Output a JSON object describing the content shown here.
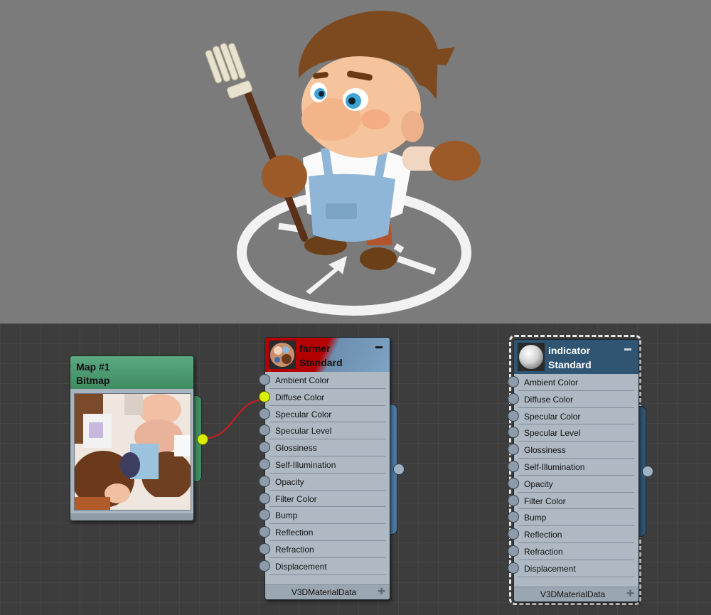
{
  "viewport": {
    "scene": "farmer-character",
    "colors": {
      "background": "#7b7b7b",
      "ring": "#f2f2f2"
    }
  },
  "editor": {
    "bitmap_node": {
      "title": "Map #1",
      "subtitle": "Bitmap",
      "header_color": "#4f9c74"
    },
    "material_nodes": [
      {
        "id": "farmer",
        "title": "farmer",
        "subtitle": "Standard",
        "icon": "texture-preview-icon",
        "slots": [
          "Ambient Color",
          "Diffuse Color",
          "Specular Color",
          "Specular Level",
          "Glossiness",
          "Self-Illumination",
          "Opacity",
          "Filter Color",
          "Bump",
          "Reflection",
          "Refraction",
          "Displacement"
        ],
        "connected_slot": "Diffuse Color",
        "footer": "V3DMaterialData"
      },
      {
        "id": "indicator",
        "title": "indicator",
        "subtitle": "Standard",
        "icon": "sphere-preview-icon",
        "selected": true,
        "slots": [
          "Ambient Color",
          "Diffuse Color",
          "Specular Color",
          "Specular Level",
          "Glossiness",
          "Self-Illumination",
          "Opacity",
          "Filter Color",
          "Bump",
          "Reflection",
          "Refraction",
          "Displacement"
        ],
        "footer": "V3DMaterialData"
      }
    ],
    "colors": {
      "wire": "#d21b1b",
      "active_socket": "#d8f000"
    }
  }
}
